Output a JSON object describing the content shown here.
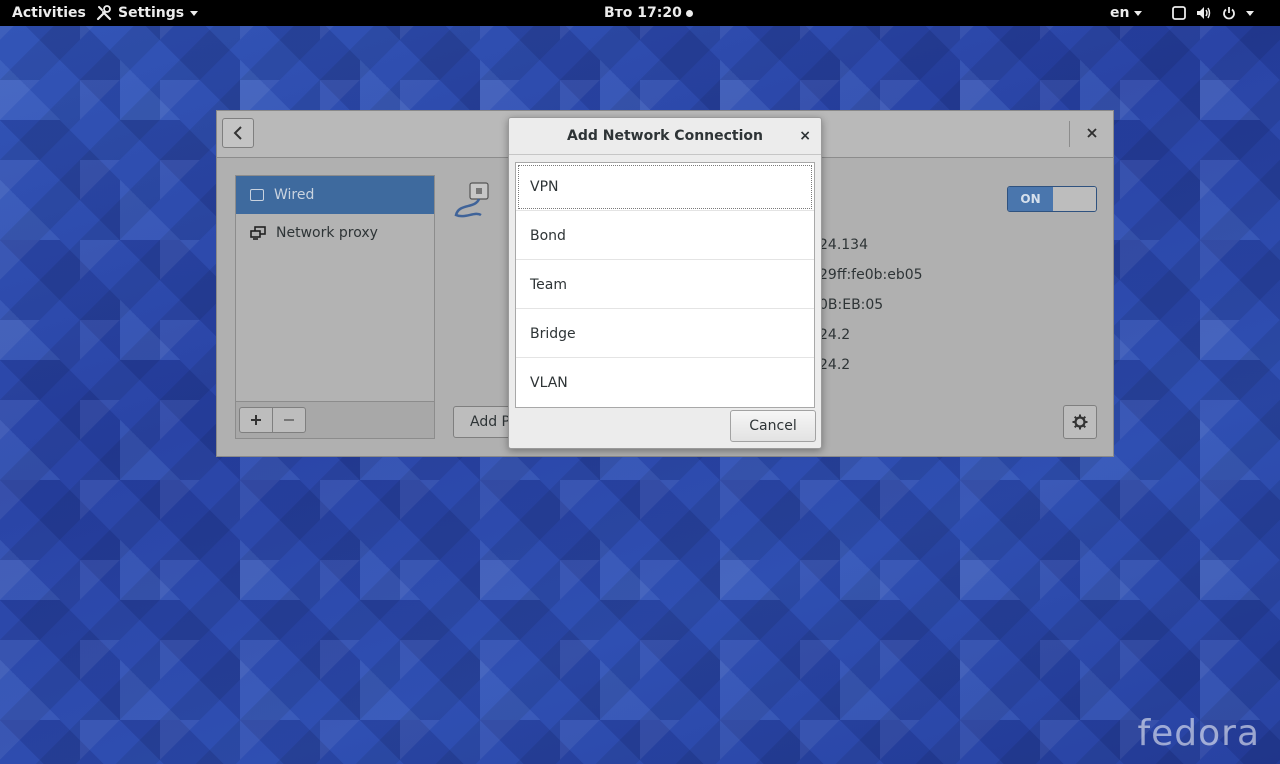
{
  "topbar": {
    "activities": "Activities",
    "app_menu": "Settings",
    "clock": "Вто 17:20",
    "language": "en"
  },
  "settings": {
    "sidebar_items": [
      {
        "label": "Wired"
      },
      {
        "label": "Network proxy"
      }
    ],
    "toggle_label": "ON",
    "details": [
      "24.134",
      "29ff:fe0b:eb05",
      "0B:EB:05",
      "24.2",
      "24.2"
    ],
    "add_profile_label": "Add P"
  },
  "dialog": {
    "title": "Add Network Connection",
    "close": "×",
    "options": [
      "VPN",
      "Bond",
      "Team",
      "Bridge",
      "VLAN"
    ],
    "cancel_label": "Cancel"
  },
  "branding": {
    "logo_text": "fedora"
  },
  "colors": {
    "selection": "#3e6a9e",
    "switch_on": "#4a76ad",
    "desktop": "#2c47a8"
  }
}
